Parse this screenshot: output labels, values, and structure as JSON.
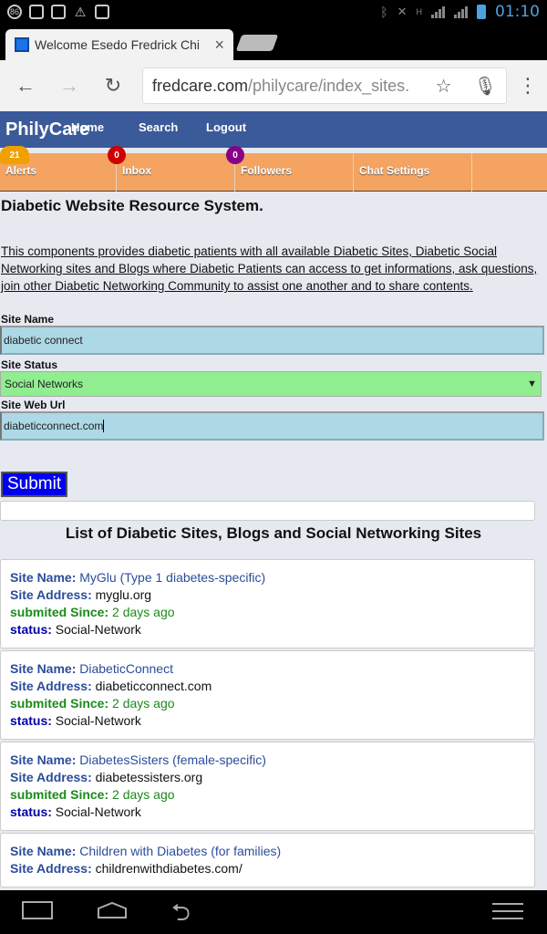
{
  "status_bar": {
    "notif_badge": "86",
    "time": "01:10",
    "network_label": "H"
  },
  "browser": {
    "tab_title": "Welcome Esedo Fredrick Chi",
    "tab_close": "×",
    "url_domain": "fredcare.com",
    "url_path": "/philycare/index_sites."
  },
  "nav": {
    "brand": "PhilyCare",
    "home": "Home",
    "search": "Search",
    "logout": "Logout"
  },
  "subnav": [
    {
      "label": "Alerts",
      "badge": "21",
      "badge_color": "orange"
    },
    {
      "label": "Inbox",
      "badge": "0",
      "badge_color": "red"
    },
    {
      "label": "Followers",
      "badge": "0",
      "badge_color": "purple"
    },
    {
      "label": "Chat Settings"
    },
    {
      "label": ""
    }
  ],
  "page": {
    "title": "Diabetic Website Resource System.",
    "intro": "This components provides diabetic patients with all available Diabetic Sites, Diabetic Social Networking sites and Blogs where Diabetic Patients can access to get informations, ask questions, join other Diabetic Networking Community to assist one another and to share contents."
  },
  "form": {
    "site_name_label": "Site Name",
    "site_name_value": "diabetic connect",
    "site_status_label": "Site Status",
    "site_status_value": "Social Networks",
    "site_url_label": "Site Web Url",
    "site_url_value": "diabeticconnect.com",
    "submit_label": "Submit"
  },
  "list": {
    "heading": "List of Diabetic Sites, Blogs and Social Networking Sites",
    "labels": {
      "name": "Site Name:",
      "address": "Site Address:",
      "since": "submited Since:",
      "status": "status:"
    },
    "sites": [
      {
        "name": "MyGlu (Type 1 diabetes-specific)",
        "address": "myglu.org",
        "since": "2 days ago",
        "status": "Social-Network"
      },
      {
        "name": "DiabeticConnect",
        "address": "diabeticconnect.com",
        "since": "2 days ago",
        "status": "Social-Network"
      },
      {
        "name": "DiabetesSisters (female-specific)",
        "address": "diabetessisters.org",
        "since": "2 days ago",
        "status": "Social-Network"
      },
      {
        "name": "Children with Diabetes (for families)",
        "address": "childrenwithdiabetes.com/",
        "since": "",
        "status": ""
      }
    ]
  },
  "colors": {
    "nav_bg": "#3b5a99",
    "subnav_bg": "#f4a460",
    "input_bg": "#add8e6",
    "select_bg": "#90ee90",
    "submit_bg": "#0000ee"
  }
}
